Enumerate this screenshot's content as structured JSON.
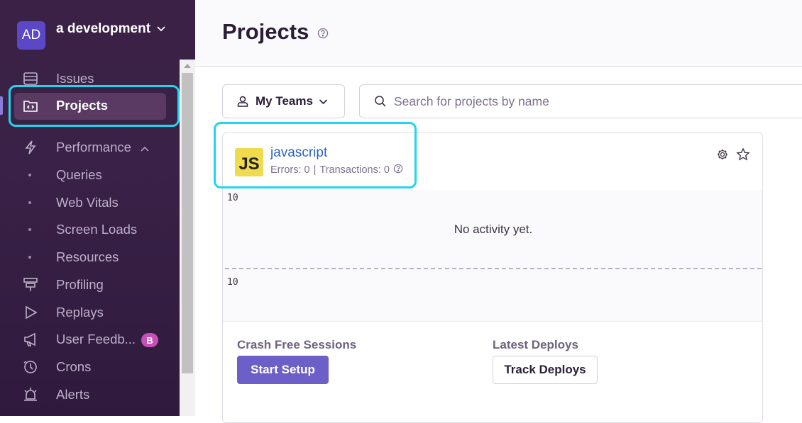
{
  "org": {
    "avatar_initials": "AD",
    "name": "a development"
  },
  "sidebar": {
    "items": [
      {
        "label": "Issues",
        "icon": "issues-icon"
      },
      {
        "label": "Projects",
        "icon": "projects-icon",
        "active": true
      },
      {
        "label": "Performance",
        "icon": "performance-icon",
        "expanded": true
      },
      {
        "label": "Queries",
        "sub": true
      },
      {
        "label": "Web Vitals",
        "sub": true
      },
      {
        "label": "Screen Loads",
        "sub": true
      },
      {
        "label": "Resources",
        "sub": true
      },
      {
        "label": "Profiling",
        "icon": "profiling-icon"
      },
      {
        "label": "Replays",
        "icon": "replays-icon"
      },
      {
        "label": "User Feedb...",
        "icon": "megaphone-icon",
        "badge": "B"
      },
      {
        "label": "Crons",
        "icon": "crons-icon"
      },
      {
        "label": "Alerts",
        "icon": "alerts-icon"
      }
    ]
  },
  "header": {
    "title": "Projects"
  },
  "filters": {
    "teams_label": "My Teams",
    "search_placeholder": "Search for projects by name"
  },
  "project": {
    "logo_text": "JS",
    "name": "javascript",
    "errors_label": "Errors: 0",
    "transactions_label": "Transactions: 0",
    "chart": {
      "tick_top": "10",
      "tick_bottom": "10",
      "empty_message": "No activity yet."
    },
    "crash_free_title": "Crash Free Sessions",
    "start_setup_label": "Start Setup",
    "latest_deploys_title": "Latest Deploys",
    "track_deploys_label": "Track Deploys"
  },
  "colors": {
    "accent": "#6c5fc7",
    "highlight": "#21d4ef",
    "link": "#2f63c8",
    "js_yellow": "#f0db4f"
  }
}
